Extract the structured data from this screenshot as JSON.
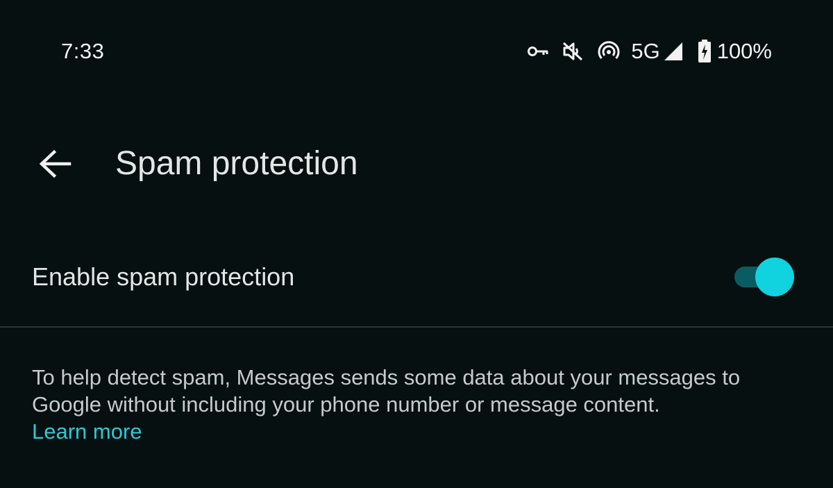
{
  "status_bar": {
    "time": "7:33",
    "network_type": "5G",
    "battery_percent": "100%",
    "icons": [
      "vpn-key-icon",
      "vibrate-off-icon",
      "hotspot-icon",
      "signal-icon",
      "battery-charging-icon"
    ]
  },
  "app_bar": {
    "title": "Spam protection",
    "back_icon": "back-arrow-icon"
  },
  "setting": {
    "label": "Enable spam protection",
    "enabled": true
  },
  "description": {
    "text": "To help detect spam, Messages sends some data about your messages to Google without including your phone number or message content.",
    "link_label": "Learn more"
  },
  "colors": {
    "background": "#061011",
    "accent": "#10d3df",
    "track": "#0a5c63",
    "link": "#2dc9d6"
  }
}
